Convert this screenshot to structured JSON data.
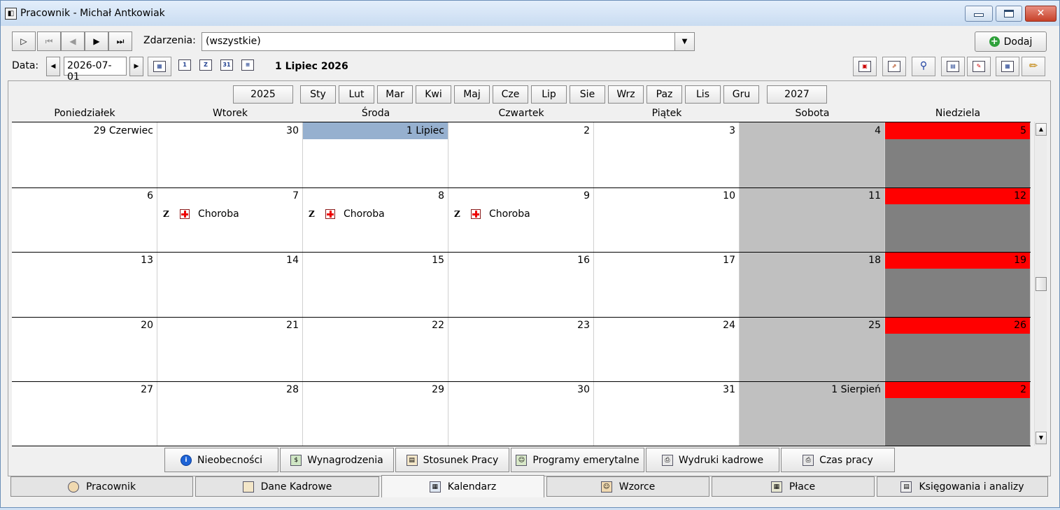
{
  "window": {
    "title": "Pracownik - Michał Antkowiak",
    "icon": "app-icon"
  },
  "nav": {
    "first": "▷",
    "prev_first": "⏮",
    "prev": "◀",
    "next": "▶",
    "last": "⏭"
  },
  "events_filter": {
    "label": "Zdarzenia:",
    "value": "(wszystkie)"
  },
  "date_field": {
    "label": "Data:",
    "value": "2026-07-01",
    "prev": "◀",
    "next": "▶"
  },
  "current_date_label": "1 Lipiec 2026",
  "view_icons": {
    "v1": "1",
    "v2": "Z",
    "v3": "31",
    "v4": "≡"
  },
  "add_button": {
    "label": "Dodaj"
  },
  "years": {
    "prev": "2025",
    "next": "2027"
  },
  "months": [
    "Sty",
    "Lut",
    "Mar",
    "Kwi",
    "Maj",
    "Cze",
    "Lip",
    "Sie",
    "Wrz",
    "Paz",
    "Lis",
    "Gru"
  ],
  "weekdays": [
    "Poniedziałek",
    "Wtorek",
    "Środa",
    "Czwartek",
    "Piątek",
    "Sobota",
    "Niedziela"
  ],
  "weeks": [
    [
      "29 Czerwiec",
      "30",
      "1 Lipiec",
      "2",
      "3",
      "4",
      "5"
    ],
    [
      "6",
      "7",
      "8",
      "9",
      "10",
      "11",
      "12"
    ],
    [
      "13",
      "14",
      "15",
      "16",
      "17",
      "18",
      "19"
    ],
    [
      "20",
      "21",
      "22",
      "23",
      "24",
      "25",
      "26"
    ],
    [
      "27",
      "28",
      "29",
      "30",
      "31",
      "1 Sierpień",
      "2"
    ]
  ],
  "events": [
    {
      "z": "Z",
      "label": "Choroba"
    },
    {
      "z": "Z",
      "label": "Choroba"
    },
    {
      "z": "Z",
      "label": "Choroba"
    }
  ],
  "colors": {
    "today": "#96b0cf",
    "sunday_header": "#ff0000",
    "saturday": "#c0c0c0",
    "sunday": "#808080"
  },
  "subtabs": [
    "Nieobecności",
    "Wynagrodzenia",
    "Stosunek Pracy",
    "Programy emerytalne",
    "Wydruki kadrowe",
    "Czas pracy"
  ],
  "tabs": [
    "Pracownik",
    "Dane Kadrowe",
    "Kalendarz",
    "Wzorce",
    "Płace",
    "Księgowania i analizy"
  ],
  "active_tab": "Kalendarz"
}
